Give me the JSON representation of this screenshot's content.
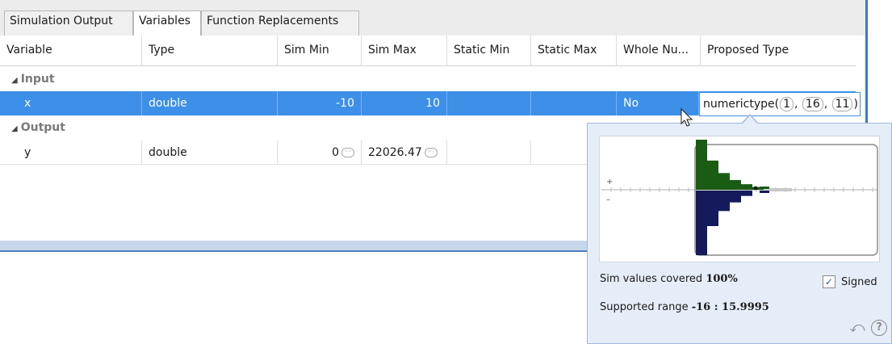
{
  "tabs": [
    {
      "label": "Simulation Output",
      "active": false
    },
    {
      "label": "Variables",
      "active": true
    },
    {
      "label": "Function Replacements",
      "active": false
    }
  ],
  "columns": [
    "Variable",
    "Type",
    "Sim Min",
    "Sim Max",
    "Static Min",
    "Static Max",
    "Whole Nu...",
    "Proposed Type"
  ],
  "groups": {
    "input": {
      "label": "Input",
      "rows": [
        {
          "variable": "x",
          "type": "double",
          "sim_min": "-10",
          "sim_max": "10",
          "static_min": "",
          "static_max": "",
          "whole_number": "No",
          "selected": true
        }
      ]
    },
    "output": {
      "label": "Output",
      "rows": [
        {
          "variable": "y",
          "type": "double",
          "sim_min": "0",
          "sim_max": "22026.47",
          "static_min": "",
          "static_max": "",
          "whole_number": "",
          "selected": false
        }
      ]
    }
  },
  "proposed_type": {
    "prefix": "numerictype(",
    "signed": "1",
    "word_length": "16",
    "fraction_length": "11",
    "sep": ",",
    "suffix": ")"
  },
  "popup": {
    "plus_label": "+",
    "minus_label": "–",
    "coverage_label": "Sim values covered",
    "coverage_value": "100%",
    "signed_label": "Signed",
    "signed_checked": true,
    "range_label": "Supported range",
    "range_value": "-16 : 15.9995",
    "histogram": {
      "positive": [
        0.72,
        0.42,
        0.24,
        0.14,
        0.08,
        0.04
      ],
      "negative": [
        0.6,
        0.33,
        0.19,
        0.11,
        0.05
      ]
    }
  },
  "colors": {
    "selected_row": "#3d8fe8",
    "hist_positive": "#1a5c14",
    "hist_negative": "#141a5c",
    "accent_border": "#3f79c4"
  },
  "icons": {
    "group_expand": "collapse-triangle-icon",
    "revert": "revert-icon",
    "help": "help-icon",
    "cursor": "mouse-pointer-icon"
  }
}
